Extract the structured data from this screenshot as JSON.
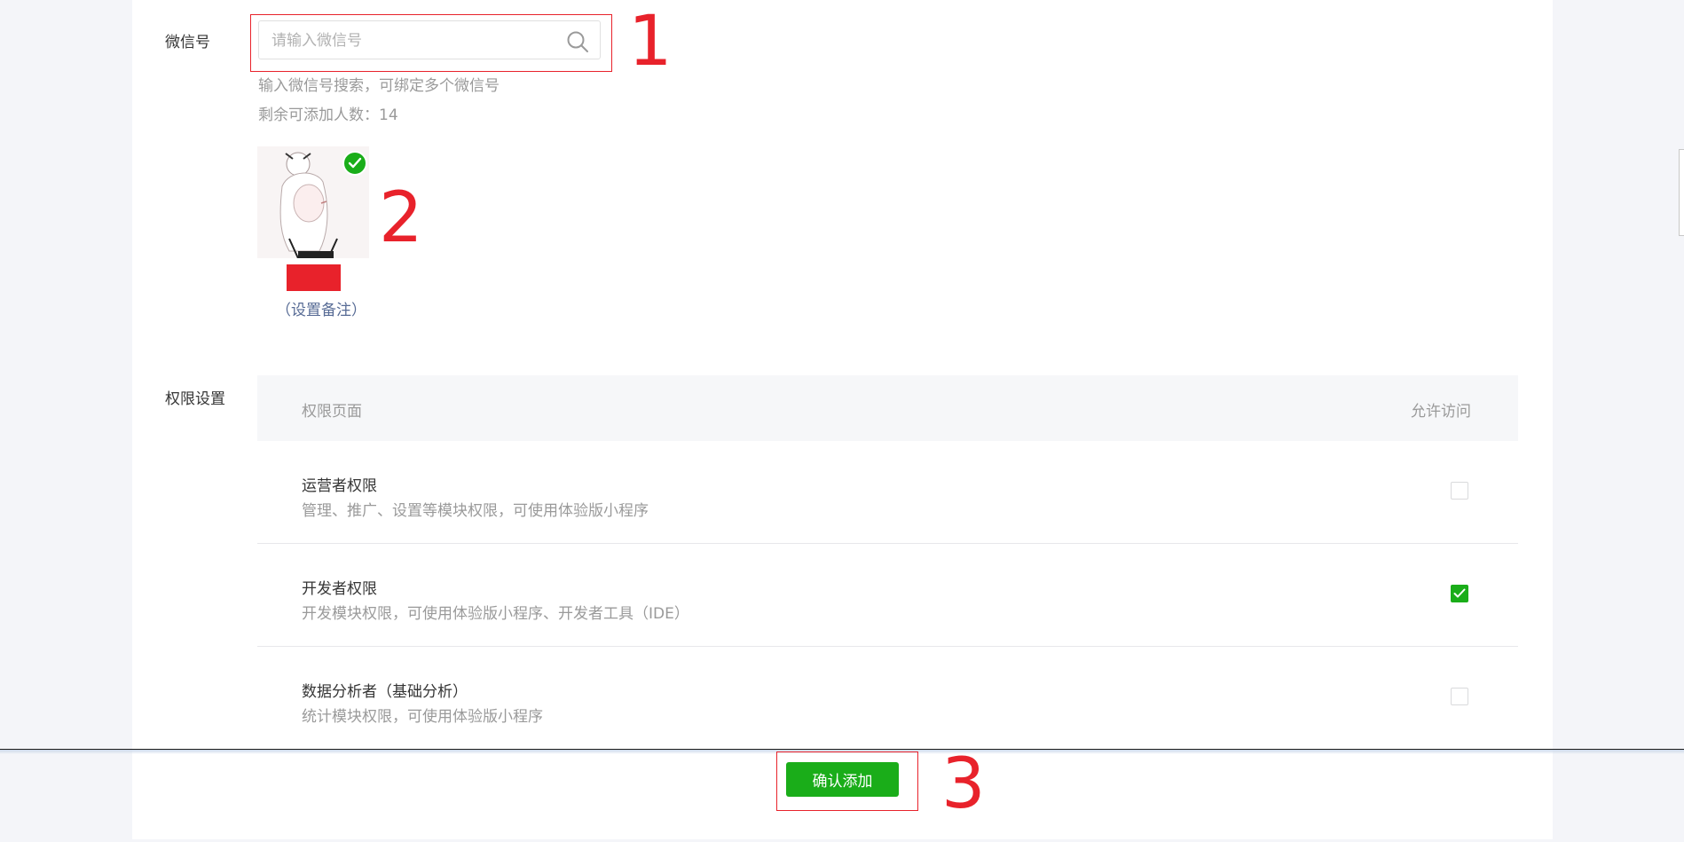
{
  "form": {
    "wechat_label": "微信号",
    "search_placeholder": "请输入微信号",
    "hint_search": "输入微信号搜索，可绑定多个微信号",
    "hint_remaining": "剩余可添加人数：14",
    "set_note_link": "（设置备注）"
  },
  "permissions": {
    "section_label": "权限设置",
    "header_page": "权限页面",
    "header_allow": "允许访问",
    "rows": [
      {
        "title": "运营者权限",
        "desc": "管理、推广、设置等模块权限，可使用体验版小程序",
        "checked": false
      },
      {
        "title": "开发者权限",
        "desc": "开发模块权限，可使用体验版小程序、开发者工具（IDE）",
        "checked": true
      },
      {
        "title": "数据分析者（基础分析）",
        "desc": "统计模块权限，可使用体验版小程序",
        "checked": false
      }
    ]
  },
  "actions": {
    "confirm_label": "确认添加"
  },
  "annotations": [
    "1",
    "2",
    "3"
  ],
  "colors": {
    "accent_green": "#1aad19",
    "annotation_red": "#e8222b",
    "link_blue": "#576b95"
  },
  "icons": [
    "search-icon",
    "check-circle-icon",
    "checkmark-icon"
  ]
}
